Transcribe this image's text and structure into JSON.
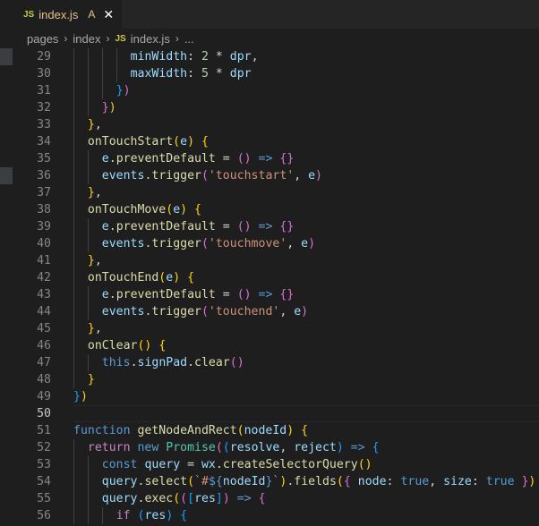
{
  "tab": {
    "icon": "JS",
    "filename": "index.js",
    "status": "A",
    "close": "✕"
  },
  "breadcrumb": {
    "items": [
      "pages",
      "index",
      "index.js",
      "..."
    ],
    "separator": "›",
    "file_icon": "JS"
  },
  "colors": {
    "editor_bg": "#1e1e1e",
    "tabbar_bg": "#252526",
    "line_number": "#858585",
    "variable": "#9cdcfe",
    "function": "#dcdcaa",
    "string": "#ce9178",
    "number": "#b5cea8",
    "keyword": "#569cd6",
    "control_keyword": "#c586c0",
    "class": "#4ec9b0"
  },
  "editor": {
    "active_line": 50,
    "lines": [
      {
        "n": "29",
        "indent": 4,
        "tokens": [
          [
            "var",
            "minWidth"
          ],
          [
            "plain",
            ": "
          ],
          [
            "num",
            "2"
          ],
          [
            "plain",
            " * "
          ],
          [
            "var",
            "dpr"
          ],
          [
            "plain",
            ","
          ]
        ]
      },
      {
        "n": "30",
        "indent": 4,
        "tokens": [
          [
            "var",
            "maxWidth"
          ],
          [
            "plain",
            ": "
          ],
          [
            "num",
            "5"
          ],
          [
            "plain",
            " * "
          ],
          [
            "var",
            "dpr"
          ]
        ]
      },
      {
        "n": "31",
        "indent": 3,
        "tokens": [
          [
            "b3",
            "}"
          ],
          [
            "b2",
            ")"
          ]
        ]
      },
      {
        "n": "32",
        "indent": 2,
        "tokens": [
          [
            "b2",
            "}"
          ],
          [
            "b1",
            ")"
          ]
        ]
      },
      {
        "n": "33",
        "indent": 1,
        "tokens": [
          [
            "b1",
            "}"
          ],
          [
            "plain",
            ","
          ]
        ]
      },
      {
        "n": "34",
        "indent": 1,
        "tokens": [
          [
            "fn",
            "onTouchStart"
          ],
          [
            "b1",
            "("
          ],
          [
            "var",
            "e"
          ],
          [
            "b1",
            ")"
          ],
          [
            "plain",
            " "
          ],
          [
            "b1",
            "{"
          ]
        ]
      },
      {
        "n": "35",
        "indent": 2,
        "tokens": [
          [
            "var",
            "e"
          ],
          [
            "plain",
            "."
          ],
          [
            "fn",
            "preventDefault"
          ],
          [
            "plain",
            " = "
          ],
          [
            "b2",
            "()"
          ],
          [
            "plain",
            " "
          ],
          [
            "kw",
            "=>"
          ],
          [
            "plain",
            " "
          ],
          [
            "b2",
            "{}"
          ]
        ]
      },
      {
        "n": "36",
        "indent": 2,
        "tokens": [
          [
            "var",
            "events"
          ],
          [
            "plain",
            "."
          ],
          [
            "fn",
            "trigger"
          ],
          [
            "b2",
            "("
          ],
          [
            "str",
            "'touchstart'"
          ],
          [
            "plain",
            ", "
          ],
          [
            "var",
            "e"
          ],
          [
            "b2",
            ")"
          ]
        ]
      },
      {
        "n": "37",
        "indent": 1,
        "tokens": [
          [
            "b1",
            "}"
          ],
          [
            "plain",
            ","
          ]
        ]
      },
      {
        "n": "38",
        "indent": 1,
        "tokens": [
          [
            "fn",
            "onTouchMove"
          ],
          [
            "b1",
            "("
          ],
          [
            "var",
            "e"
          ],
          [
            "b1",
            ")"
          ],
          [
            "plain",
            " "
          ],
          [
            "b1",
            "{"
          ]
        ]
      },
      {
        "n": "39",
        "indent": 2,
        "tokens": [
          [
            "var",
            "e"
          ],
          [
            "plain",
            "."
          ],
          [
            "fn",
            "preventDefault"
          ],
          [
            "plain",
            " = "
          ],
          [
            "b2",
            "()"
          ],
          [
            "plain",
            " "
          ],
          [
            "kw",
            "=>"
          ],
          [
            "plain",
            " "
          ],
          [
            "b2",
            "{}"
          ]
        ]
      },
      {
        "n": "40",
        "indent": 2,
        "tokens": [
          [
            "var",
            "events"
          ],
          [
            "plain",
            "."
          ],
          [
            "fn",
            "trigger"
          ],
          [
            "b2",
            "("
          ],
          [
            "str",
            "'touchmove'"
          ],
          [
            "plain",
            ", "
          ],
          [
            "var",
            "e"
          ],
          [
            "b2",
            ")"
          ]
        ]
      },
      {
        "n": "41",
        "indent": 1,
        "tokens": [
          [
            "b1",
            "}"
          ],
          [
            "plain",
            ","
          ]
        ]
      },
      {
        "n": "42",
        "indent": 1,
        "tokens": [
          [
            "fn",
            "onTouchEnd"
          ],
          [
            "b1",
            "("
          ],
          [
            "var",
            "e"
          ],
          [
            "b1",
            ")"
          ],
          [
            "plain",
            " "
          ],
          [
            "b1",
            "{"
          ]
        ]
      },
      {
        "n": "43",
        "indent": 2,
        "tokens": [
          [
            "var",
            "e"
          ],
          [
            "plain",
            "."
          ],
          [
            "fn",
            "preventDefault"
          ],
          [
            "plain",
            " = "
          ],
          [
            "b2",
            "()"
          ],
          [
            "plain",
            " "
          ],
          [
            "kw",
            "=>"
          ],
          [
            "plain",
            " "
          ],
          [
            "b2",
            "{}"
          ]
        ]
      },
      {
        "n": "44",
        "indent": 2,
        "tokens": [
          [
            "var",
            "events"
          ],
          [
            "plain",
            "."
          ],
          [
            "fn",
            "trigger"
          ],
          [
            "b2",
            "("
          ],
          [
            "str",
            "'touchend'"
          ],
          [
            "plain",
            ", "
          ],
          [
            "var",
            "e"
          ],
          [
            "b2",
            ")"
          ]
        ]
      },
      {
        "n": "45",
        "indent": 1,
        "tokens": [
          [
            "b1",
            "}"
          ],
          [
            "plain",
            ","
          ]
        ]
      },
      {
        "n": "46",
        "indent": 1,
        "tokens": [
          [
            "fn",
            "onClear"
          ],
          [
            "b1",
            "()"
          ],
          [
            "plain",
            " "
          ],
          [
            "b1",
            "{"
          ]
        ]
      },
      {
        "n": "47",
        "indent": 2,
        "tokens": [
          [
            "kw",
            "this"
          ],
          [
            "plain",
            "."
          ],
          [
            "var",
            "signPad"
          ],
          [
            "plain",
            "."
          ],
          [
            "fn",
            "clear"
          ],
          [
            "b2",
            "()"
          ]
        ]
      },
      {
        "n": "48",
        "indent": 1,
        "tokens": [
          [
            "b1",
            "}"
          ]
        ]
      },
      {
        "n": "49",
        "indent": 0,
        "tokens": [
          [
            "b3",
            "}"
          ],
          [
            "b1",
            ")"
          ]
        ]
      },
      {
        "n": "50",
        "indent": 0,
        "tokens": []
      },
      {
        "n": "51",
        "indent": 0,
        "tokens": [
          [
            "kw",
            "function"
          ],
          [
            "plain",
            " "
          ],
          [
            "fn",
            "getNodeAndRect"
          ],
          [
            "b1",
            "("
          ],
          [
            "var",
            "nodeId"
          ],
          [
            "b1",
            ")"
          ],
          [
            "plain",
            " "
          ],
          [
            "b1",
            "{"
          ]
        ]
      },
      {
        "n": "52",
        "indent": 1,
        "tokens": [
          [
            "ctrl",
            "return"
          ],
          [
            "plain",
            " "
          ],
          [
            "kw",
            "new"
          ],
          [
            "plain",
            " "
          ],
          [
            "cls",
            "Promise"
          ],
          [
            "b2",
            "("
          ],
          [
            "b3",
            "("
          ],
          [
            "var",
            "resolve"
          ],
          [
            "plain",
            ", "
          ],
          [
            "var",
            "reject"
          ],
          [
            "b3",
            ")"
          ],
          [
            "plain",
            " "
          ],
          [
            "kw",
            "=>"
          ],
          [
            "plain",
            " "
          ],
          [
            "b3",
            "{"
          ]
        ]
      },
      {
        "n": "53",
        "indent": 2,
        "tokens": [
          [
            "kw",
            "const"
          ],
          [
            "plain",
            " "
          ],
          [
            "var",
            "query"
          ],
          [
            "plain",
            " = "
          ],
          [
            "var",
            "wx"
          ],
          [
            "plain",
            "."
          ],
          [
            "fn",
            "createSelectorQuery"
          ],
          [
            "b1",
            "()"
          ]
        ]
      },
      {
        "n": "54",
        "indent": 2,
        "tokens": [
          [
            "var",
            "query"
          ],
          [
            "plain",
            "."
          ],
          [
            "fn",
            "select"
          ],
          [
            "b1",
            "("
          ],
          [
            "str",
            "`#"
          ],
          [
            "kw",
            "${"
          ],
          [
            "var",
            "nodeId"
          ],
          [
            "kw",
            "}"
          ],
          [
            "str",
            "`"
          ],
          [
            "b1",
            ")"
          ],
          [
            "plain",
            "."
          ],
          [
            "fn",
            "fields"
          ],
          [
            "b1",
            "("
          ],
          [
            "b2",
            "{"
          ],
          [
            "plain",
            " "
          ],
          [
            "var",
            "node"
          ],
          [
            "plain",
            ": "
          ],
          [
            "kw",
            "true"
          ],
          [
            "plain",
            ", "
          ],
          [
            "var",
            "size"
          ],
          [
            "plain",
            ": "
          ],
          [
            "kw",
            "true"
          ],
          [
            "plain",
            " "
          ],
          [
            "b2",
            "}"
          ],
          [
            "b1",
            ")"
          ]
        ]
      },
      {
        "n": "55",
        "indent": 2,
        "tokens": [
          [
            "var",
            "query"
          ],
          [
            "plain",
            "."
          ],
          [
            "fn",
            "exec"
          ],
          [
            "b1",
            "("
          ],
          [
            "b2",
            "("
          ],
          [
            "b3",
            "["
          ],
          [
            "var",
            "res"
          ],
          [
            "b3",
            "]"
          ],
          [
            "b2",
            ")"
          ],
          [
            "plain",
            " "
          ],
          [
            "kw",
            "=>"
          ],
          [
            "plain",
            " "
          ],
          [
            "b2",
            "{"
          ]
        ]
      },
      {
        "n": "56",
        "indent": 3,
        "tokens": [
          [
            "ctrl",
            "if"
          ],
          [
            "plain",
            " "
          ],
          [
            "b3",
            "("
          ],
          [
            "var",
            "res"
          ],
          [
            "b3",
            ")"
          ],
          [
            "plain",
            " "
          ],
          [
            "b3",
            "{"
          ]
        ]
      }
    ]
  }
}
